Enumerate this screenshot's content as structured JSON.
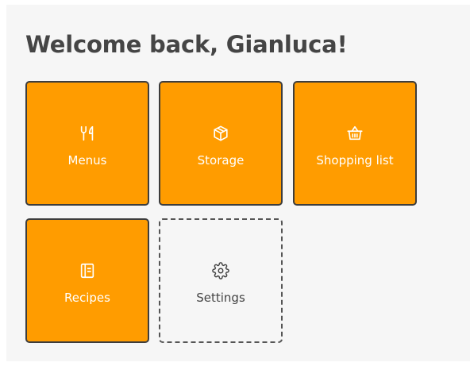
{
  "header": {
    "title": "Welcome back, Gianluca!"
  },
  "tiles": [
    {
      "label": "Menus",
      "icon": "fork-knife-icon",
      "style": "filled"
    },
    {
      "label": "Storage",
      "icon": "box-icon",
      "style": "filled"
    },
    {
      "label": "Shopping list",
      "icon": "basket-icon",
      "style": "filled"
    },
    {
      "label": "Recipes",
      "icon": "book-icon",
      "style": "filled"
    },
    {
      "label": "Settings",
      "icon": "gear-icon",
      "style": "dashed"
    }
  ],
  "colors": {
    "accent": "#ff9c00",
    "border": "#3d3d3d",
    "background": "#f6f6f6",
    "title": "#454545"
  }
}
